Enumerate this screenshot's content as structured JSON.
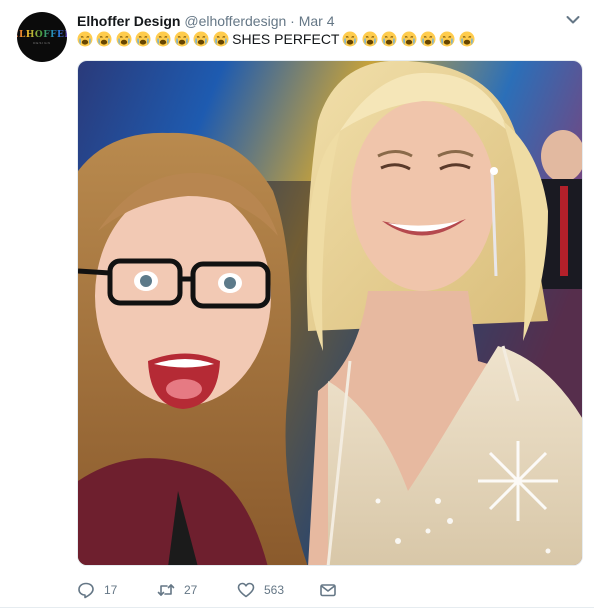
{
  "tweet": {
    "author_name": "Elhoffer Design",
    "author_handle": "@elhofferdesign",
    "separator": "·",
    "date": "Mar 4",
    "emoji_before": [
      "crying-face",
      "crying-face",
      "crying-face",
      "crying-face",
      "crying-face",
      "crying-face",
      "crying-face",
      "crying-face"
    ],
    "text": "SHES PERFECT",
    "emoji_after": [
      "crying-face",
      "crying-face",
      "crying-face",
      "crying-face",
      "crying-face",
      "crying-face",
      "crying-face"
    ],
    "avatar_logo": "ELHOFFER",
    "avatar_logo_sub": "DESIGN"
  },
  "actions": {
    "reply_count": "17",
    "retweet_count": "27",
    "like_count": "563"
  },
  "icons": {
    "menu": "chevron-down-icon",
    "reply": "reply-icon",
    "retweet": "retweet-icon",
    "like": "heart-icon",
    "dm": "envelope-icon"
  },
  "colors": {
    "name": "#14171a",
    "secondary": "#657786",
    "emoji_face": "#ffcc4d",
    "emoji_tear": "#5dadec"
  }
}
